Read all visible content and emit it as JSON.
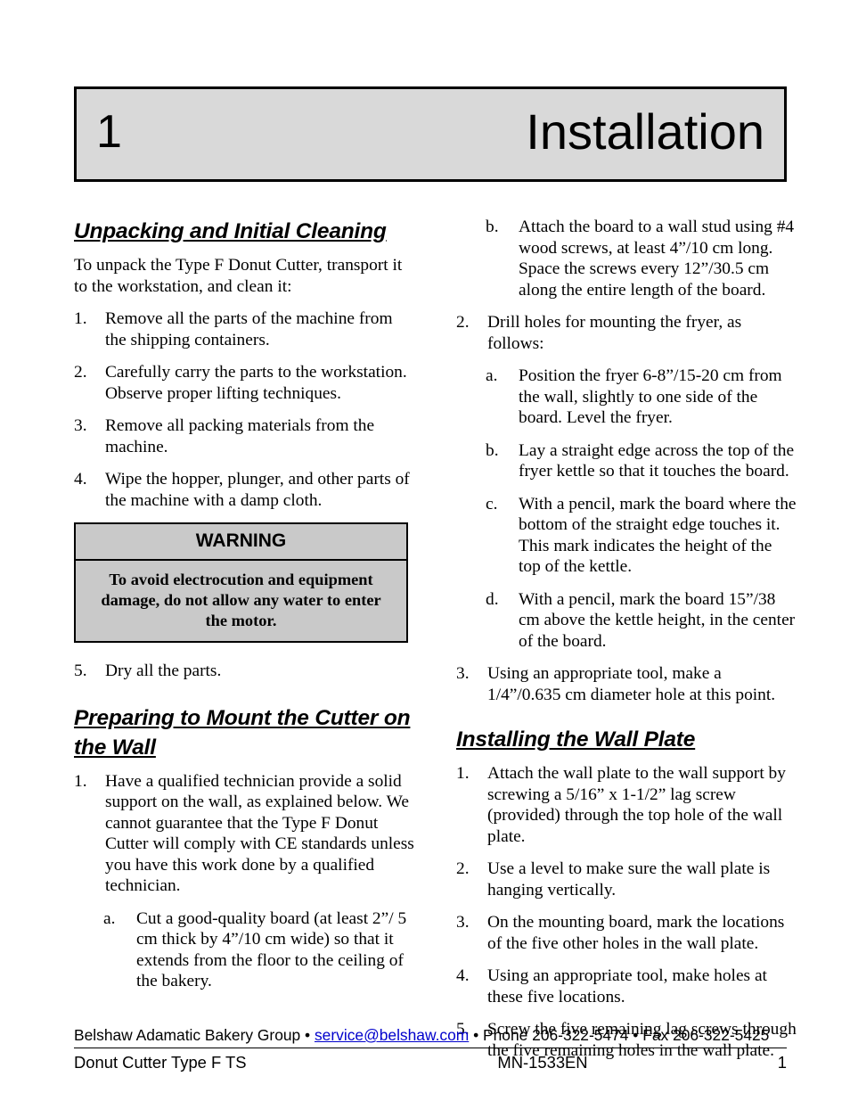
{
  "chapter": {
    "number": "1",
    "title": "Installation"
  },
  "left_column": {
    "heading1": "Unpacking and Initial Cleaning",
    "intro": "To unpack the Type F Donut Cutter, transport it to the workstation, and clean it:",
    "steps": [
      {
        "marker": "1.",
        "text": "Remove all the parts of the machine from the shipping containers."
      },
      {
        "marker": "2.",
        "text": "Carefully carry the parts to the workstation. Observe proper lifting techniques."
      },
      {
        "marker": "3.",
        "text": "Remove all packing materials from the machine."
      },
      {
        "marker": "4.",
        "text": "Wipe the hopper, plunger, and other parts of the machine with a damp cloth."
      }
    ],
    "warning": {
      "title": "WARNING",
      "text": "To avoid electrocution and equipment damage, do not allow any water to enter the motor."
    },
    "steps_after_warning": [
      {
        "marker": "5.",
        "text": "Dry all the parts."
      }
    ],
    "heading2": "Preparing to Mount the Cutter on the Wall",
    "mount_steps": [
      {
        "marker": "1.",
        "text": "Have a qualified technician provide a solid support on the wall, as explained below.  We cannot guarantee that the Type F Donut Cutter will comply with CE standards unless you have this work done by a qualified technician."
      }
    ],
    "mount_substeps": [
      {
        "marker": "a.",
        "text": "Cut a good-quality board (at least 2”/ 5 cm thick by 4”/10 cm wide) so that it extends from the floor to the ceiling of the bakery."
      }
    ]
  },
  "right_column": {
    "continued_substeps": [
      {
        "marker": "b.",
        "text": "Attach the board to a wall stud using #4 wood screws, at least 4”/10 cm long. Space the screws every 12”/30.5 cm along the entire length of the board."
      }
    ],
    "step2": {
      "marker": "2.",
      "text": "Drill holes for mounting the fryer, as follows:"
    },
    "step2_substeps": [
      {
        "marker": "a.",
        "text": "Position the fryer 6-8”/15-20 cm from the wall, slightly to one side of the board.  Level the fryer."
      },
      {
        "marker": "b.",
        "text": "Lay a straight edge across the top of the fryer kettle so that it touches the board."
      },
      {
        "marker": "c.",
        "text": "With a pencil, mark the board where the bottom of the straight edge touches it. This mark indicates the height of the top of the kettle."
      },
      {
        "marker": "d.",
        "text": "With a pencil, mark the board 15”/38 cm above the kettle height, in the center of the board."
      }
    ],
    "step3": {
      "marker": "3.",
      "text": "Using an appropriate tool, make a 1/4”/0.635 cm diameter hole at this point."
    },
    "heading": "Installing the Wall Plate",
    "wall_plate_steps": [
      {
        "marker": "1.",
        "text": "Attach the wall plate to the wall support by screwing a 5/16” x 1-1/2” lag screw (provided) through the top hole of the wall plate."
      },
      {
        "marker": "2.",
        "text": "Use a level to make sure the wall plate is hanging vertically."
      },
      {
        "marker": "3.",
        "text": "On the mounting board, mark the locations of the five other holes in the wall plate."
      },
      {
        "marker": "4.",
        "text": "Using an appropriate tool, make holes at these five locations."
      },
      {
        "marker": "5.",
        "text": "Screw the five remaining lag screws through the five remaining holes in the wall plate."
      }
    ]
  },
  "footer": {
    "company": "Belshaw Adamatic Bakery Group",
    "separator1": " • ",
    "email": "service@belshaw.com",
    "separator2": " • ",
    "phone": "Phone 206-322-5474",
    "separator3": " • ",
    "fax": "Fax 206-322-5425",
    "document_title": "Donut Cutter Type F TS",
    "document_number": "MN-1533EN",
    "page_number": "1"
  },
  "colors": {
    "banner_bg": "#d9d9d9",
    "warning_bg": "#c9c9c9",
    "link": "#0000cc",
    "text": "#000000"
  }
}
